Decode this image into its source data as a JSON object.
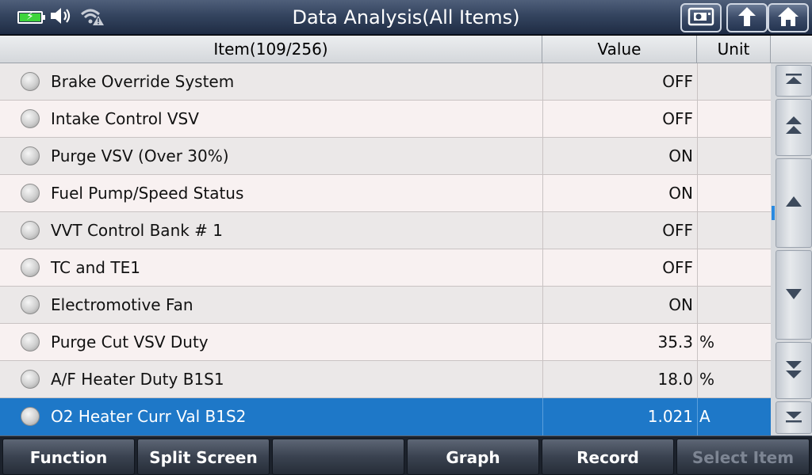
{
  "header": {
    "title": "Data Analysis(All Items)"
  },
  "status": {
    "battery_icon": "battery-charging-icon",
    "volume_icon": "speaker-volume-icon",
    "wifi_icon": "wifi-warning-icon",
    "battery_color": "#3ed43b"
  },
  "title_buttons": {
    "screenshot_icon": "camera-save-icon",
    "back_icon": "back-arrow-icon",
    "home_icon": "home-icon"
  },
  "table": {
    "columns": {
      "item": "Item(109/256)",
      "value": "Value",
      "unit": "Unit"
    },
    "rows": [
      {
        "name": "Brake Override System",
        "value": "OFF",
        "unit": ""
      },
      {
        "name": "Intake Control VSV",
        "value": "OFF",
        "unit": ""
      },
      {
        "name": "Purge VSV (Over 30%)",
        "value": "ON",
        "unit": ""
      },
      {
        "name": "Fuel Pump/Speed Status",
        "value": "ON",
        "unit": ""
      },
      {
        "name": "VVT Control Bank # 1",
        "value": "OFF",
        "unit": ""
      },
      {
        "name": "TC and TE1",
        "value": "OFF",
        "unit": ""
      },
      {
        "name": "Electromotive Fan",
        "value": "ON",
        "unit": ""
      },
      {
        "name": "Purge Cut VSV Duty",
        "value": "35.3",
        "unit": "%"
      },
      {
        "name": "A/F Heater Duty B1S1",
        "value": "18.0",
        "unit": "%"
      },
      {
        "name": "O2 Heater Curr Val B1S2",
        "value": "1.021",
        "unit": "A"
      }
    ],
    "selected_index": 9,
    "selected_color": "#1e78c8"
  },
  "toolbar": {
    "function": "Function",
    "split_screen": "Split Screen",
    "empty": "",
    "graph": "Graph",
    "record": "Record",
    "select_item": "Select Item"
  }
}
